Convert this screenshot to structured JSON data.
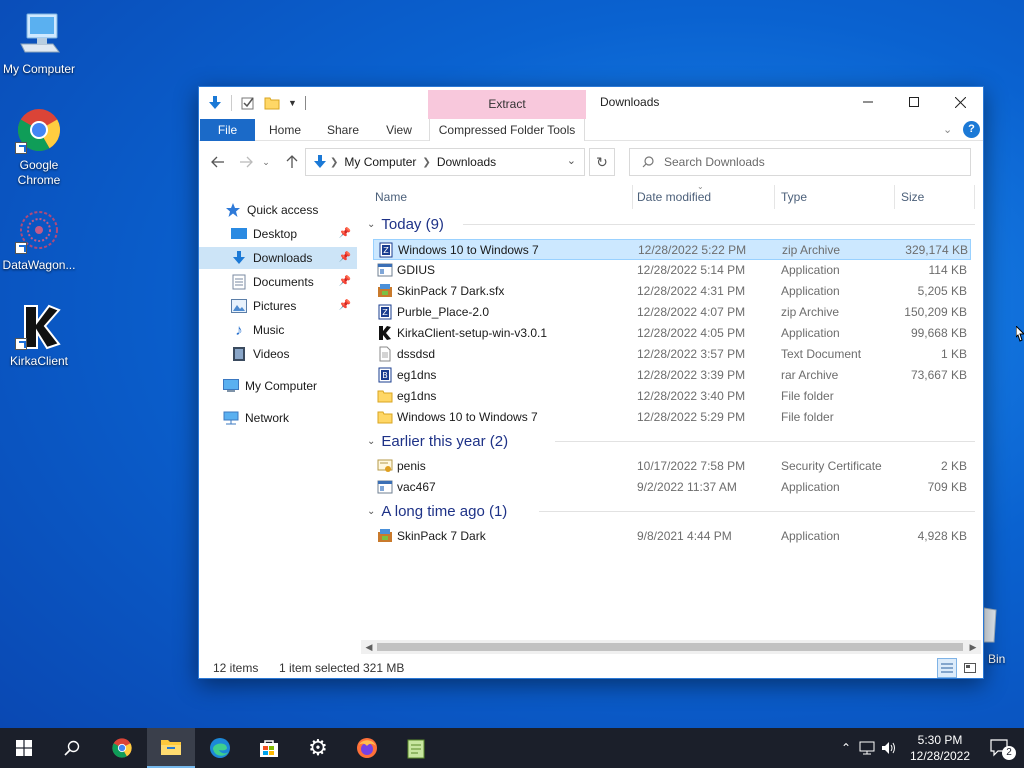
{
  "desktop": {
    "icons": [
      {
        "label": "My Computer"
      },
      {
        "label": "Google Chrome"
      },
      {
        "label": "DataWagon..."
      },
      {
        "label": "KirkaClient"
      }
    ],
    "recycle_label_partial": "Bin"
  },
  "window": {
    "title": "Downloads",
    "context_tab": "Extract",
    "ribbon_tabs": {
      "file": "File",
      "home": "Home",
      "share": "Share",
      "view": "View",
      "compressed": "Compressed Folder Tools"
    },
    "address": {
      "crumbs": [
        "My Computer",
        "Downloads"
      ]
    },
    "search_placeholder": "Search Downloads",
    "nav": {
      "quick_access": "Quick access",
      "items": [
        "Desktop",
        "Downloads",
        "Documents",
        "Pictures",
        "Music",
        "Videos"
      ],
      "my_computer": "My Computer",
      "network": "Network"
    },
    "columns": {
      "name": "Name",
      "date": "Date modified",
      "type": "Type",
      "size": "Size"
    },
    "groups": [
      {
        "title": "Today (9)",
        "files": [
          {
            "name": "Windows 10 to Windows 7",
            "date": "12/28/2022 5:22 PM",
            "type": "zip Archive",
            "size": "329,174 KB",
            "icon": "zip-icon"
          },
          {
            "name": "GDIUS",
            "date": "12/28/2022 5:14 PM",
            "type": "Application",
            "size": "114 KB",
            "icon": "application-icon"
          },
          {
            "name": "SkinPack 7 Dark.sfx",
            "date": "12/28/2022 4:31 PM",
            "type": "Application",
            "size": "5,205 KB",
            "icon": "installer-icon"
          },
          {
            "name": "Purble_Place-2.0",
            "date": "12/28/2022 4:07 PM",
            "type": "zip Archive",
            "size": "150,209 KB",
            "icon": "zip-icon"
          },
          {
            "name": "KirkaClient-setup-win-v3.0.1",
            "date": "12/28/2022 4:05 PM",
            "type": "Application",
            "size": "99,668 KB",
            "icon": "kirka-icon"
          },
          {
            "name": "dssdsd",
            "date": "12/28/2022 3:57 PM",
            "type": "Text Document",
            "size": "1 KB",
            "icon": "text-file-icon"
          },
          {
            "name": "eg1dns",
            "date": "12/28/2022 3:39 PM",
            "type": "rar Archive",
            "size": "73,667 KB",
            "icon": "rar-icon"
          },
          {
            "name": "eg1dns",
            "date": "12/28/2022 3:40 PM",
            "type": "File folder",
            "size": "",
            "icon": "folder-icon"
          },
          {
            "name": "Windows 10 to Windows 7",
            "date": "12/28/2022 5:29 PM",
            "type": "File folder",
            "size": "",
            "icon": "folder-icon"
          }
        ]
      },
      {
        "title": "Earlier this year (2)",
        "files": [
          {
            "name": "penis",
            "date": "10/17/2022 7:58 PM",
            "type": "Security Certificate",
            "size": "2 KB",
            "icon": "certificate-icon"
          },
          {
            "name": "vac467",
            "date": "9/2/2022 11:37 AM",
            "type": "Application",
            "size": "709 KB",
            "icon": "application-icon"
          }
        ]
      },
      {
        "title": "A long time ago (1)",
        "files": [
          {
            "name": "SkinPack 7 Dark",
            "date": "9/8/2021 4:44 PM",
            "type": "Application",
            "size": "4,928 KB",
            "icon": "installer-icon"
          }
        ]
      }
    ],
    "status": {
      "count": "12 items",
      "selected": "1 item selected",
      "size": "321 MB"
    }
  },
  "taskbar": {
    "time": "5:30 PM",
    "date": "12/28/2022",
    "notifications": "2"
  },
  "colors": {
    "accent": "#1b6ac8",
    "selection": "#cce8ff",
    "group_header": "#1e3287",
    "extract_tab": "#f8c8dc"
  }
}
